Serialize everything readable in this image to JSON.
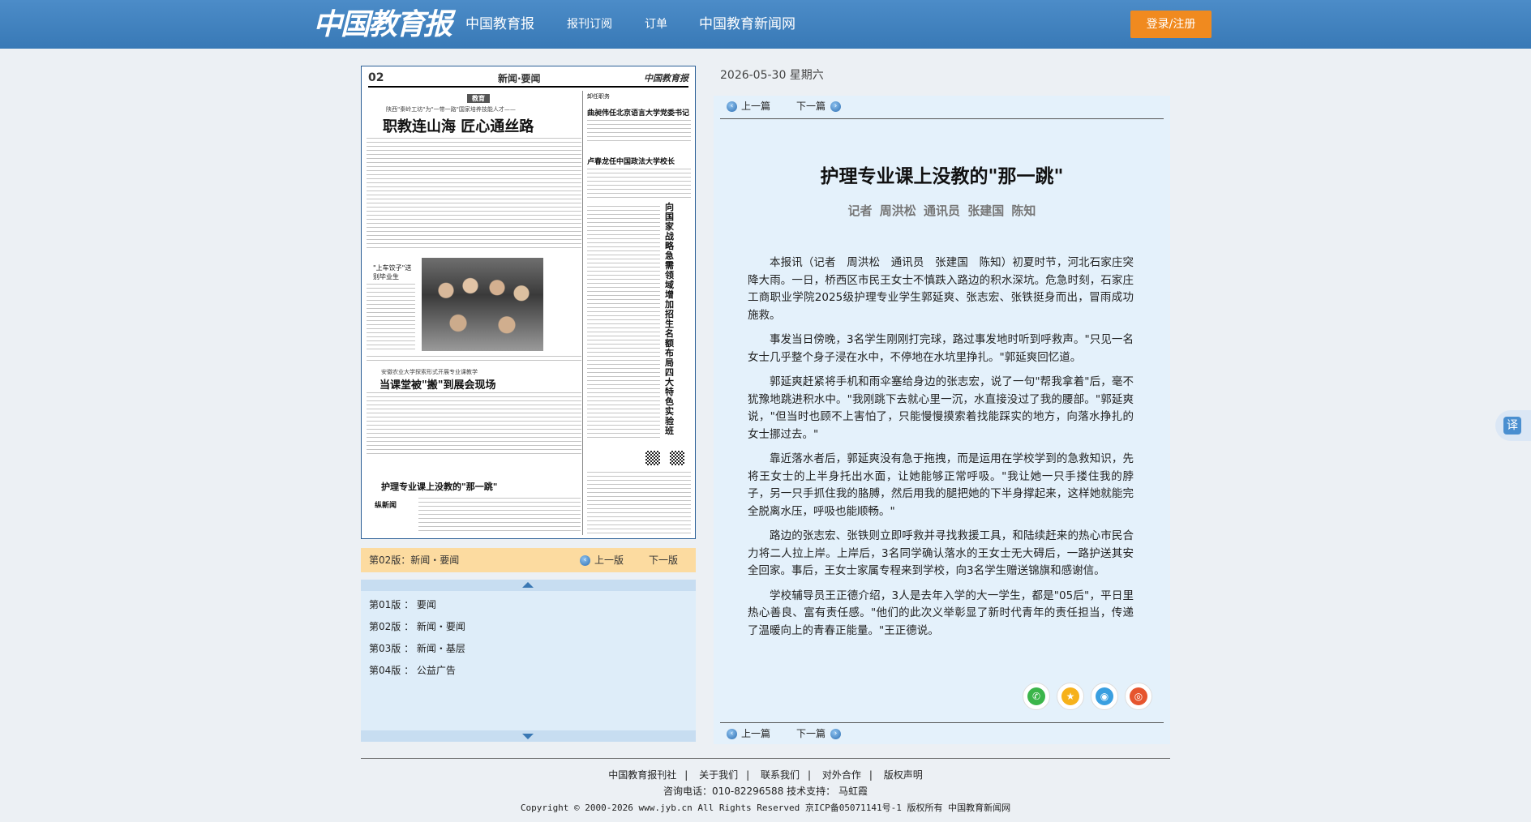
{
  "header": {
    "logo_text": "中国教育报",
    "nav": [
      "中国教育报",
      "报刊订阅",
      "订单",
      "中国教育新闻网"
    ],
    "login_label": "登录/注册"
  },
  "paper": {
    "page_num": "02",
    "section": "新闻·要闻",
    "masthead": "中国教育报",
    "tag": "教育",
    "kicker1": "陕西\"秦岭工坊\"为\"一带一路\"国家培养技能人才——",
    "headline1": "职教连山海 匠心通丝路",
    "side_col_title": "卸任职务",
    "side_h1": "曲昶伟任北京语言大学党委书记",
    "side_h2": "卢春龙任中国政法大学校长",
    "photo_caption": "\"上车饺子\"送别毕业生",
    "kicker2": "安徽农业大学探索形式开展专业课教学",
    "headline2": "当课堂被\"搬\"到展会现场",
    "headline3": "护理专业课上没教的\"那一跳\"",
    "brand_small": "纵新闻",
    "vertical_head": "向国家战略急需领域增加招生名额 布局四大特色实验班"
  },
  "page_bar": {
    "current": "第02版：新闻・要闻",
    "prev": "上一版",
    "next": "下一版"
  },
  "editions": [
    "第01版 ： 要闻",
    "第02版 ： 新闻・要闻",
    "第03版 ： 新闻・基层",
    "第04版 ： 公益广告"
  ],
  "article": {
    "date": "2026-05-30  星期六",
    "prev": "上一篇",
    "next": "下一篇",
    "title": "护理专业课上没教的\"那一跳\"",
    "byline": "记者 周洪松 通讯员 张建国 陈知",
    "paragraphs": [
      "本报讯（记者　周洪松　通讯员　张建国　陈知）初夏时节，河北石家庄突降大雨。一日，桥西区市民王女士不慎跌入路边的积水深坑。危急时刻，石家庄工商职业学院2025级护理专业学生郭延爽、张志宏、张铁挺身而出，冒雨成功施救。",
      "事发当日傍晚，3名学生刚刚打完球，路过事发地时听到呼救声。\"只见一名女士几乎整个身子浸在水中，不停地在水坑里挣扎。\"郭延爽回忆道。",
      "郭延爽赶紧将手机和雨伞塞给身边的张志宏，说了一句\"帮我拿着\"后，毫不犹豫地跳进积水中。\"我刚跳下去就心里一沉，水直接没过了我的腰部。\"郭延爽说，\"但当时也顾不上害怕了，只能慢慢摸索着找能踩实的地方，向落水挣扎的女士挪过去。\"",
      "靠近落水者后，郭延爽没有急于拖拽，而是运用在学校学到的急救知识，先将王女士的上半身托出水面，让她能够正常呼吸。\"我让她一只手搂住我的脖子，另一只手抓住我的胳膊，然后用我的腿把她的下半身撑起来，这样她就能完全脱离水压，呼吸也能顺畅。\"",
      "路边的张志宏、张铁则立即呼救并寻找救援工具，和陆续赶来的热心市民合力将二人拉上岸。上岸后，3名同学确认落水的王女士无大碍后，一路护送其安全回家。事后，王女士家属专程来到学校，向3名学生赠送锦旗和感谢信。",
      "学校辅导员王正德介绍，3人是去年入学的大一学生，都是\"05后\"，平日里热心善良、富有责任感。\"他们的此次义举彰显了新时代青年的责任担当，传递了温暖向上的青春正能量。\"王正德说。"
    ],
    "share_icons": [
      "wechat-icon",
      "star-icon",
      "qq-icon",
      "weibo-icon"
    ]
  },
  "side_float": {
    "label": "译"
  },
  "footer": {
    "links": [
      "中国教育报刊社",
      "关于我们",
      "联系我们",
      "对外合作",
      "版权声明"
    ],
    "contact": "咨询电话：010-82296588  技术支持： 马虹霞",
    "copyright": "Copyright © 2000-2026 www.jyb.cn All Rights Reserved 京ICP备05071141号-1 版权所有 中国教育新闻网"
  },
  "colors": {
    "topbar": "#3d80bd",
    "login": "#f08a1f",
    "page_bar": "#fcdba0",
    "article_bg": "#e4f1fb"
  }
}
